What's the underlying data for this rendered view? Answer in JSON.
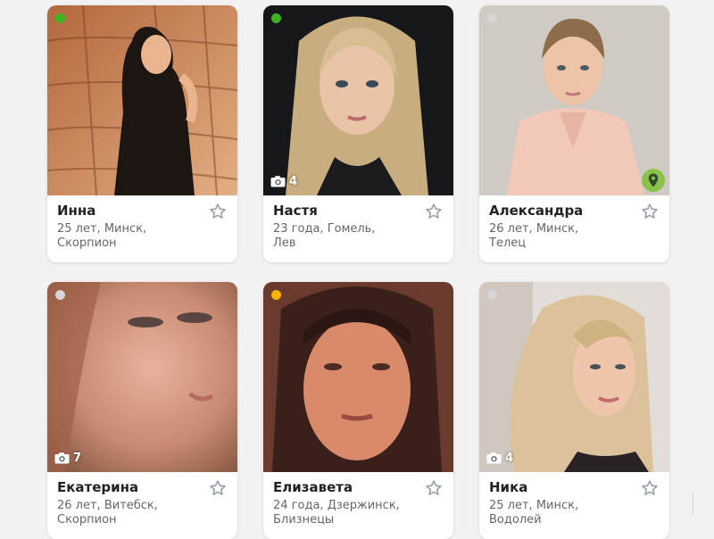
{
  "colors": {
    "online": "#3cb521",
    "away": "#f7b500",
    "offline": "#d6d6d6",
    "location": "#8bc34a",
    "star": "#9aa3ad"
  },
  "profiles": [
    {
      "name": "Инна",
      "age": "25 лет,",
      "city": "Минск,",
      "zodiac": "Скорпион",
      "status": "online",
      "photo_count": "",
      "location_icon": false
    },
    {
      "name": "Настя",
      "age": "23 года,",
      "city": "Гомель,",
      "zodiac": "Лев",
      "status": "online",
      "photo_count": "4",
      "location_icon": false
    },
    {
      "name": "Александра",
      "age": "26 лет,",
      "city": "Минск,",
      "zodiac": "Телец",
      "status": "offline",
      "photo_count": "",
      "location_icon": true
    },
    {
      "name": "Екатерина",
      "age": "26 лет,",
      "city": "Витебск,",
      "zodiac": "Скорпион",
      "status": "offline",
      "photo_count": "7",
      "location_icon": false
    },
    {
      "name": "Елизавета",
      "age": "24 года,",
      "city": "Дзержинск,",
      "zodiac": "Близнецы",
      "status": "away",
      "photo_count": "",
      "location_icon": false
    },
    {
      "name": "Ника",
      "age": "25 лет,",
      "city": "Минск,",
      "zodiac": "Водолей",
      "status": "offline",
      "photo_count": "4",
      "location_icon": false
    }
  ],
  "icons": {
    "status": "status-dot-icon",
    "camera": "camera-icon",
    "location": "map-pin-icon",
    "favorite": "star-outline-icon"
  }
}
